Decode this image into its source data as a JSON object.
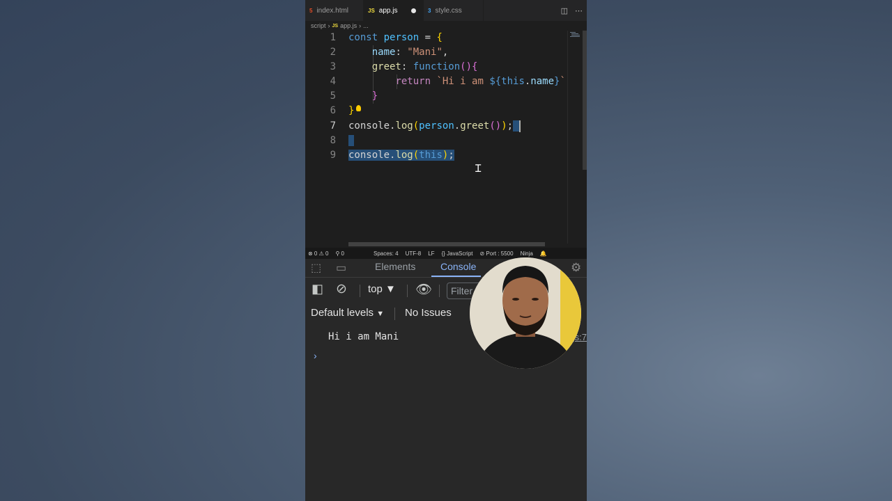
{
  "editor": {
    "tabs": [
      {
        "icon": "html-file-icon",
        "label": "index.html",
        "active": false
      },
      {
        "icon": "js-file-icon",
        "label": "app.js",
        "active": true,
        "unsaved": true
      },
      {
        "icon": "css-file-icon",
        "label": "style.css",
        "active": false
      }
    ],
    "breadcrumb": {
      "folder": "script",
      "file": "app.js",
      "ellipsis": "..."
    },
    "line_numbers": [
      "1",
      "2",
      "3",
      "4",
      "5",
      "6",
      "7",
      "8",
      "9"
    ],
    "code_lines": [
      "const person = {",
      "    name: \"Mani\",",
      "    greet: function(){",
      "        return `Hi i am ${this.name}`",
      "    }",
      "}",
      "console.log(person.greet());",
      "",
      "console.log(this);"
    ],
    "current_line": 7,
    "selected_lines": [
      7,
      8,
      9
    ]
  },
  "statusbar": {
    "errors": "⊗ 0 ⚠ 0",
    "ports": "⚲ 0",
    "spaces": "Spaces: 4",
    "encoding": "UTF-8",
    "eol": "LF",
    "language": "{} JavaScript",
    "port": "⊘ Port : 5500",
    "ninja": "Ninja"
  },
  "devtools": {
    "tabs": [
      "Elements",
      "Console"
    ],
    "active_tab": "Console",
    "context": "top",
    "filter_placeholder": "Filter",
    "levels": "Default levels",
    "issues": "No Issues",
    "messages": [
      {
        "text": "Hi i am Mani",
        "source": "app.js:7"
      }
    ],
    "prompt": "›"
  },
  "colors": {
    "editor_bg": "#1e1e1e",
    "selection": "#264f78",
    "keyword": "#569cd6",
    "string": "#ce9178",
    "function": "#dcdcaa",
    "console_accent": "#8ab4f8"
  }
}
